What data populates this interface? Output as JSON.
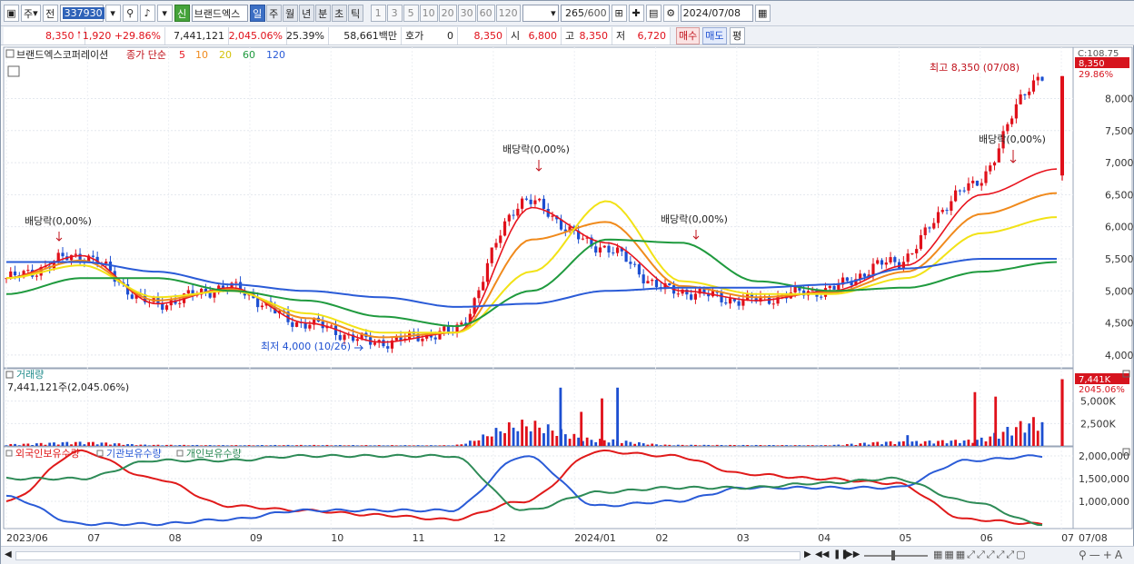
{
  "toolbar": {
    "period_unit": "주",
    "prev_label": "전",
    "stock_code": "337930",
    "credit_badge": "신",
    "stock_name": "브랜드엑스",
    "periods": [
      "일",
      "주",
      "월",
      "년",
      "분",
      "초",
      "틱"
    ],
    "active_period": "일",
    "intervals": [
      "1",
      "3",
      "5",
      "10",
      "20",
      "30",
      "60",
      "120"
    ],
    "count": "265",
    "count_total": "/600",
    "date": "2024/07/08"
  },
  "quote": {
    "price": "8,350",
    "change": "1,920",
    "change_pct": "+29.86%",
    "volume": "7,441,121",
    "volume_ratio": "2,045.06%",
    "turnover": "25.39%",
    "amount": "58,661백만",
    "hoga_label": "호가",
    "hoga_value": "0",
    "ask": "8,350",
    "open_label": "시",
    "open": "6,800",
    "high_label": "고",
    "high": "8,350",
    "low_label": "저",
    "low": "6,720",
    "buy_label": "매수",
    "sell_label": "매도",
    "avg_label": "평"
  },
  "price_panel": {
    "name": "브랜드엑스코퍼레이션",
    "legend_prefix": "종가 단순",
    "ma": [
      {
        "period": "5",
        "color": "#e8141e"
      },
      {
        "period": "10",
        "color": "#f08a1c"
      },
      {
        "period": "20",
        "color": "#f2e216"
      },
      {
        "period": "60",
        "color": "#1f9a3e"
      },
      {
        "period": "120",
        "color": "#2a5bd7"
      }
    ],
    "axis_top_label": "C:108.75",
    "last_price_tag": "8,350",
    "last_pct_tag": "29.86%",
    "y_ticks": [
      "8,000",
      "7,500",
      "7,000",
      "6,500",
      "6,000",
      "5,500",
      "5,000",
      "4,500",
      "4,000"
    ],
    "annotations": {
      "high_note": "최고 8,350 (07/08)",
      "low_note": "최저 4,000 (10/26)",
      "ex_dividend": [
        "배당락(0,00%)",
        "배당락(0,00%)",
        "배당락(0,00%)",
        "배당락(0,00%)"
      ]
    }
  },
  "volume_panel": {
    "title": "거래량",
    "value_text": "7,441,121주(2,045.06%)",
    "last_tag": "7,441K",
    "last_pct_tag": "2045.06%",
    "y_ticks": [
      "5,000K",
      "2,500K"
    ]
  },
  "holdings_panel": {
    "series": [
      {
        "name": "외국인보유수량",
        "color": "#e01a1a"
      },
      {
        "name": "기관보유수량",
        "color": "#2a5bd7"
      },
      {
        "name": "개인보유수량",
        "color": "#2e8b57"
      }
    ],
    "y_ticks": [
      "2,000,000",
      "1,500,000",
      "1,000,000"
    ]
  },
  "x_axis": {
    "labels": [
      "2023/06",
      "07",
      "08",
      "09",
      "10",
      "11",
      "12",
      "2024/01",
      "02",
      "03",
      "04",
      "05",
      "06",
      "07"
    ],
    "right_label": "07/08"
  },
  "chart_data": [
    {
      "type": "line",
      "title": "브랜드엑스코퍼레이션",
      "x": [
        "2023/06",
        "07",
        "08",
        "09",
        "10",
        "11",
        "12",
        "2024/01",
        "02",
        "03",
        "04",
        "05",
        "06",
        "07",
        "07/08"
      ],
      "series": [
        {
          "name": "종가",
          "values": [
            5200,
            5550,
            4800,
            5050,
            4500,
            4200,
            4350,
            6400,
            5700,
            5000,
            4850,
            5000,
            5450,
            6600,
            8350
          ]
        },
        {
          "name": "5",
          "values": [
            5200,
            5550,
            4800,
            5050,
            4500,
            4200,
            4350,
            6300,
            5750,
            5000,
            4850,
            5000,
            5400,
            6500,
            6900
          ]
        },
        {
          "name": "20",
          "values": [
            5200,
            5400,
            4900,
            5000,
            4650,
            4350,
            4350,
            5300,
            6400,
            5150,
            4950,
            4950,
            5200,
            5900,
            6150
          ]
        },
        {
          "name": "60",
          "values": [
            4950,
            5200,
            5200,
            5000,
            4850,
            4600,
            4450,
            5000,
            5800,
            5750,
            5150,
            5000,
            5050,
            5300,
            5450
          ]
        },
        {
          "name": "120",
          "values": [
            5450,
            5450,
            5300,
            5100,
            5000,
            4900,
            4750,
            4800,
            5000,
            5050,
            5050,
            5100,
            5350,
            5500,
            5500
          ]
        }
      ],
      "ylim": [
        3800,
        8800
      ],
      "high": {
        "value": 8350,
        "date": "07/08"
      },
      "low": {
        "value": 4000,
        "date": "10/26"
      }
    },
    {
      "type": "bar",
      "title": "거래량",
      "x": [
        "2023/06",
        "07",
        "08",
        "09",
        "10",
        "11",
        "12",
        "2024/01",
        "02",
        "03",
        "04",
        "05",
        "06",
        "07",
        "07/08"
      ],
      "values": [
        500,
        1100,
        300,
        200,
        250,
        200,
        180,
        6500,
        1800,
        300,
        250,
        200,
        1200,
        1600,
        7441
      ],
      "ylim": [
        0,
        8000
      ],
      "unit": "K"
    },
    {
      "type": "line",
      "x": [
        "2023/06",
        "07",
        "08",
        "09",
        "10",
        "11",
        "12",
        "2024/01",
        "02",
        "03",
        "04",
        "05",
        "06",
        "07",
        "07/08"
      ],
      "series": [
        {
          "name": "외국인보유수량",
          "values": [
            1000000,
            2100000,
            1500000,
            900000,
            800000,
            700000,
            600000,
            1000000,
            2100000,
            2000000,
            1600000,
            1500000,
            1400000,
            600000,
            500000
          ]
        },
        {
          "name": "기관보유수량",
          "values": [
            1100000,
            500000,
            500000,
            600000,
            800000,
            800000,
            800000,
            2000000,
            900000,
            1000000,
            1300000,
            1300000,
            1300000,
            1900000,
            2000000
          ]
        },
        {
          "name": "개인보유수량",
          "values": [
            1500000,
            1500000,
            1900000,
            1900000,
            2000000,
            2000000,
            2000000,
            800000,
            1200000,
            1300000,
            1300000,
            1400000,
            1500000,
            1000000,
            500000
          ]
        }
      ],
      "ylim": [
        400000,
        2200000
      ]
    }
  ]
}
